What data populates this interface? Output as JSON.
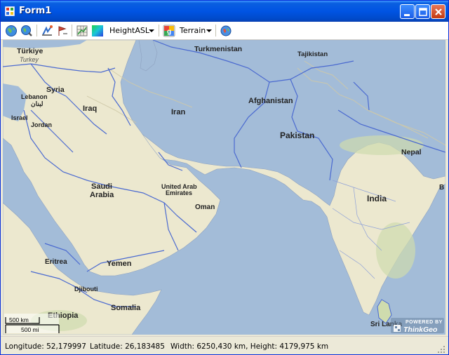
{
  "window": {
    "title": "Form1"
  },
  "toolbar": {
    "layer_select": "HeightASL",
    "basemap_select": "Terrain"
  },
  "map": {
    "labels": {
      "turkiye": "Türkiye",
      "turkey": "Turkey",
      "syria": "Syria",
      "lebanon": "Lebanon",
      "lebanon_native": "لبنان",
      "israel": "Israel",
      "jordan": "Jordan",
      "iraq": "Iraq",
      "iran": "Iran",
      "turkmenistan": "Turkmenistan",
      "tajikistan": "Tajikistan",
      "afghanistan": "Afghanistan",
      "pakistan": "Pakistan",
      "nepal": "Nepal",
      "india": "India",
      "saudi": "Saudi",
      "arabia": "Arabia",
      "uae1": "United Arab",
      "uae2": "Emirates",
      "oman": "Oman",
      "yemen": "Yemen",
      "eritrea": "Eritrea",
      "djibouti": "Djibouti",
      "ethiopia": "Ethiopia",
      "somalia": "Somalia",
      "srilanka": "Sri Lanka",
      "edge_b": "B"
    },
    "scale": {
      "km": "500 km",
      "mi": "500 mi"
    },
    "attribution": {
      "powered": "POWERED BY",
      "brand": "ThinkGeo"
    }
  },
  "status": {
    "longitude": "Longitude: 52,179997",
    "latitude": "Latitude: 26,183485",
    "extent": "Width: 6250,430 km, Height: 4179,975 km"
  },
  "colors": {
    "water": "#a3bcd8",
    "land": "#ece8cf",
    "border": "#4b6ad0",
    "titlebar": "#0054e3"
  }
}
